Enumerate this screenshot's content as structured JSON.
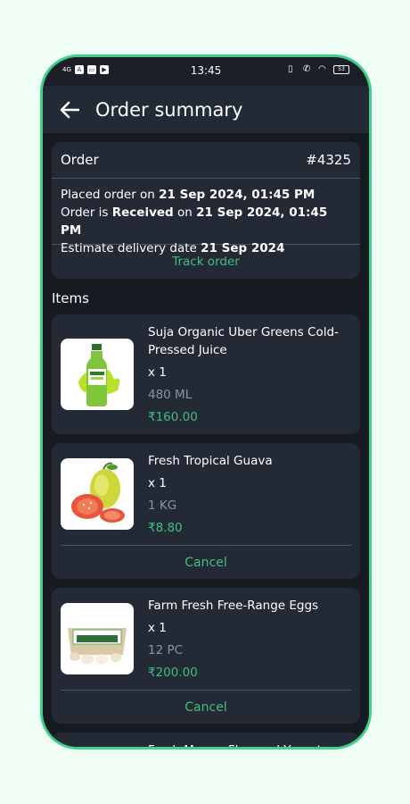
{
  "status": {
    "network": "4G",
    "time": "13:45",
    "battery": "53"
  },
  "header": {
    "title": "Order summary"
  },
  "order": {
    "label": "Order",
    "number": "#4325",
    "placed_prefix": "Placed order on ",
    "placed_date": "21 Sep 2024, 01:45 PM",
    "status_prefix": "Order is ",
    "status_value": "Received",
    "status_mid": " on ",
    "status_date": "21 Sep 2024, 01:45 PM",
    "delivery_prefix": "Estimate delivery date ",
    "delivery_date": "21 Sep 2024",
    "track_label": "Track order"
  },
  "items_heading": "Items",
  "items": [
    {
      "name": "Suja Organic Uber Greens Cold-Pressed Juice",
      "qty": "x 1",
      "unit": "480 ML",
      "price": "₹160.00"
    },
    {
      "name": "Fresh Tropical Guava",
      "qty": "x 1",
      "unit": "1 KG",
      "price": "₹8.80",
      "cancel_label": "Cancel"
    },
    {
      "name": "Farm Fresh Free-Range Eggs",
      "qty": "x 1",
      "unit": "12 PC",
      "price": "₹200.00",
      "cancel_label": "Cancel"
    },
    {
      "name": "Fresh Mango Flavored Yogurt"
    }
  ],
  "colors": {
    "accent": "#3fbf80",
    "frame": "#3fd08a",
    "background": "#161b22",
    "card": "#232a35"
  }
}
